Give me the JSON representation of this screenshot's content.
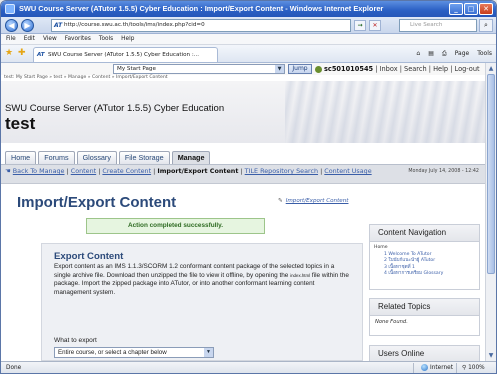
{
  "window": {
    "title": "SWU Course Server (ATutor 1.5.5) Cyber Education : Import/Export Content - Windows Internet Explorer",
    "min": "_",
    "max": "□",
    "close": "✕"
  },
  "address": {
    "url": "http://course.swu.ac.th/tools/ims/index.php?cid=0",
    "search_placeholder": "Live Search",
    "go": "→",
    "stop": "✕",
    "search_go": "⌕"
  },
  "menu": [
    "File",
    "Edit",
    "View",
    "Favorites",
    "Tools",
    "Help"
  ],
  "tab": {
    "label": "SWU Course Server (ATutor 1.5.5) Cyber Education :..."
  },
  "toolbar": {
    "home": "⌂",
    "feeds": "▤",
    "print": "⎙",
    "page": "Page",
    "tools": "Tools"
  },
  "jump": {
    "select_value": "My Start Page",
    "button": "Jump",
    "user": "sc501010545",
    "links": "| Inbox | Search | Help | Log-out"
  },
  "breadcrumb": "test: My Start Page » test » Manage » Content » Import/Export Content",
  "site_title": "SWU Course Server (ATutor 1.5.5) Cyber Education",
  "course_name": "test",
  "tabs": [
    "Home",
    "Forums",
    "Glossary",
    "File Storage",
    "Manage"
  ],
  "subnav": {
    "hand": "☚",
    "back": "Back To  Manage",
    "content": "Content",
    "create": "Create Content",
    "current": "Import/Export Content",
    "tile": "TILE Repository Search",
    "usage": "Content Usage",
    "sep": "|",
    "date": "Monday July 14, 2008 - 12:42"
  },
  "page": {
    "title": "Import/Export Content",
    "help_link": "Import/Export Content",
    "help_icon": "✎"
  },
  "feedback": "Action completed successfully.",
  "export": {
    "heading": "Export Content",
    "desc_1": "Export content as an IMS 1.1.3/SCORM 1.2 conformant content package of the selected topics in a single archive file. Download then unzipped the file to view it offline, by opening the ",
    "desc_small": "index.html",
    "desc_2": " file within the package. Import the zipped package into ATutor, or into another conformant learning content management system.",
    "what_label": "What to export",
    "what_value": "Entire course, or select a chapter below"
  },
  "side": {
    "nav_title": "Content Navigation",
    "nav_home": "Home",
    "nav_items": [
      "1 Welcome To ATutor",
      "2 ใบนับก์แนะนำผู้ ATutor",
      "3 เนื้อหาชุดที่ 1",
      "4 เนื้อหาการเตรียม Glossary"
    ],
    "related_title": "Related Topics",
    "related_body": "None Found.",
    "users_title": "Users Online"
  },
  "status": {
    "left": "Done",
    "zone": "Internet",
    "zoom": "100%"
  }
}
